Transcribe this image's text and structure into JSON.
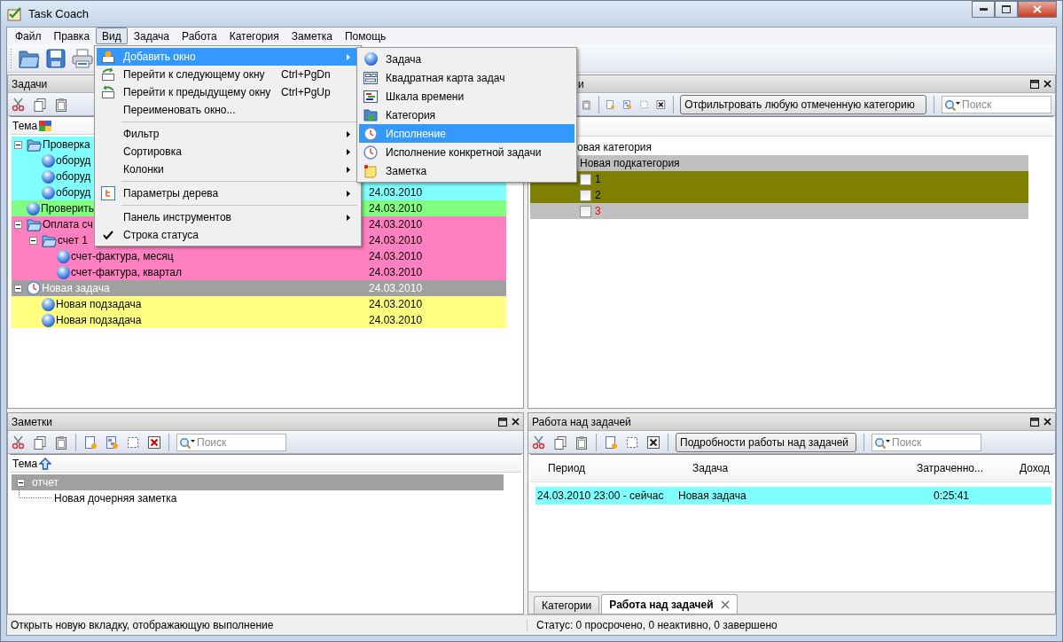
{
  "window": {
    "title": "Task Coach"
  },
  "menubar": [
    {
      "label": "Файл",
      "selected": false
    },
    {
      "label": "Правка",
      "selected": false
    },
    {
      "label": "Вид",
      "selected": true
    },
    {
      "label": "Задача",
      "selected": false
    },
    {
      "label": "Работа",
      "selected": false
    },
    {
      "label": "Категория",
      "selected": false
    },
    {
      "label": "Заметка",
      "selected": false
    },
    {
      "label": "Помощь",
      "selected": false
    }
  ],
  "view_menu": [
    {
      "kind": "add",
      "label": "Добавить окно",
      "submenu": true,
      "selected": true
    },
    {
      "kind": "next",
      "label": "Перейти к следующему окну",
      "shortcut": "Ctrl+PgDn",
      "selected": false
    },
    {
      "kind": "prev",
      "label": "Перейти к предыдущему окну",
      "shortcut": "Ctrl+PgUp",
      "selected": false
    },
    {
      "kind": "plain",
      "label": "Переименовать окно...",
      "selected": false
    },
    {
      "kind": "separator"
    },
    {
      "kind": "plain",
      "label": "Фильтр",
      "submenu": true,
      "selected": false
    },
    {
      "kind": "plain",
      "label": "Сортировка",
      "submenu": true,
      "selected": false
    },
    {
      "kind": "plain",
      "label": "Колонки",
      "submenu": true,
      "selected": false
    },
    {
      "kind": "separator"
    },
    {
      "kind": "tree",
      "label": "Параметры дерева",
      "submenu": true,
      "selected": false
    },
    {
      "kind": "separator"
    },
    {
      "kind": "plain",
      "label": "Панель инструментов",
      "submenu": true,
      "selected": false
    },
    {
      "kind": "plain",
      "label": "Строка статуса",
      "checked": true,
      "selected": false
    }
  ],
  "add_submenu": [
    {
      "kind": "task",
      "label": "Задача",
      "selected": false
    },
    {
      "kind": "taskmap",
      "label": "Квадратная карта задач",
      "selected": false
    },
    {
      "kind": "timeline",
      "label": "Шкала времени",
      "selected": false
    },
    {
      "kind": "category",
      "label": "Категория",
      "selected": false
    },
    {
      "kind": "effort",
      "label": "Исполнение",
      "selected": true
    },
    {
      "kind": "effort",
      "label": "Исполнение конкретной задачи",
      "selected": false
    },
    {
      "kind": "note",
      "label": "Заметка",
      "selected": false
    }
  ],
  "tasks_panel": {
    "title": "Задачи",
    "column": "Тема",
    "tasks": [
      {
        "label": "Проверка",
        "color": "#80ffff",
        "expanded": true,
        "active": false,
        "children": [
          {
            "label": "оборуд",
            "color": "#80ffff",
            "active": false
          },
          {
            "label": "оборуд",
            "color": "#80ffff",
            "active": false
          },
          {
            "label": "оборуд",
            "color": "#80ffff",
            "active": false,
            "date": "24.03.2010"
          }
        ]
      },
      {
        "label": "Проверить",
        "color": "#80ff80",
        "active": false,
        "date": "24.03.2010"
      },
      {
        "label": "Оплата сч",
        "color": "#ff80c0",
        "expanded": true,
        "active": false,
        "date": "24.03.2010",
        "children": [
          {
            "label": "счет 1",
            "color": "#ff80c0",
            "expanded": true,
            "active": false,
            "date": "24.03.2010",
            "children": [
              {
                "label": "счет-фактура, месяц",
                "color": "#ff80c0",
                "active": false,
                "date": "24.03.2010"
              },
              {
                "label": "счет-фактура, квартал",
                "color": "#ff80c0",
                "active": false,
                "date": "24.03.2010"
              }
            ]
          }
        ]
      },
      {
        "label": "Новая задача",
        "color": "#a0a0a0",
        "expanded": true,
        "active": true,
        "date": "24.03.2010",
        "children": [
          {
            "label": "Новая подзадача",
            "color": "#ffff80",
            "active": false,
            "date": "24.03.2010"
          },
          {
            "label": "Новая подзадача",
            "color": "#ffff80",
            "active": false,
            "date": "24.03.2010"
          }
        ]
      }
    ]
  },
  "categories_panel": {
    "title": "и",
    "filter": "Отфильтровать любую отмеченную категорию",
    "search": {
      "placeholder": "Поиск"
    },
    "categories": [
      {
        "label": "овая категория",
        "children": [
          {
            "label": "Новая подкатегория",
            "color": "#c0c0c0",
            "children": [
              {
                "label": "1",
                "color": "#808000",
                "warning": false,
                "checked": false
              },
              {
                "label": "2",
                "color": "#808000",
                "warning": false,
                "checked": false
              },
              {
                "label": "3",
                "color": "#c0c0c0",
                "warning": true,
                "checked": false
              }
            ]
          }
        ]
      }
    ]
  },
  "notes_panel": {
    "title": "Заметки",
    "search": {
      "placeholder": "Поиск"
    },
    "column": "Тема",
    "notes": [
      {
        "label": "отчет",
        "color": "#a0a0a0",
        "expanded": true,
        "children": [
          {
            "label": "Новая дочерняя заметка"
          }
        ]
      }
    ]
  },
  "effort_panel": {
    "title": "Работа над задачей",
    "view": "Подробности работы над задачей",
    "search": {
      "placeholder": "Поиск"
    },
    "columns": [
      "Период",
      "Задача",
      "Затраченно...",
      "Доход"
    ],
    "rows": [
      {
        "period": "24.03.2010 23:00 - сейчас",
        "task": "Новая задача",
        "spent": "0:25:41",
        "color": "#80ffff"
      }
    ],
    "tabs": [
      {
        "label": "Категории",
        "selected": false
      },
      {
        "label": "Работа над задачей",
        "selected": true,
        "closable": true
      }
    ]
  },
  "status_bar": {
    "message": "Открыть новую вкладку, отображающую выполнение",
    "status": "Статус: 0 просрочено, 0 неактивно, 0 завершено"
  }
}
